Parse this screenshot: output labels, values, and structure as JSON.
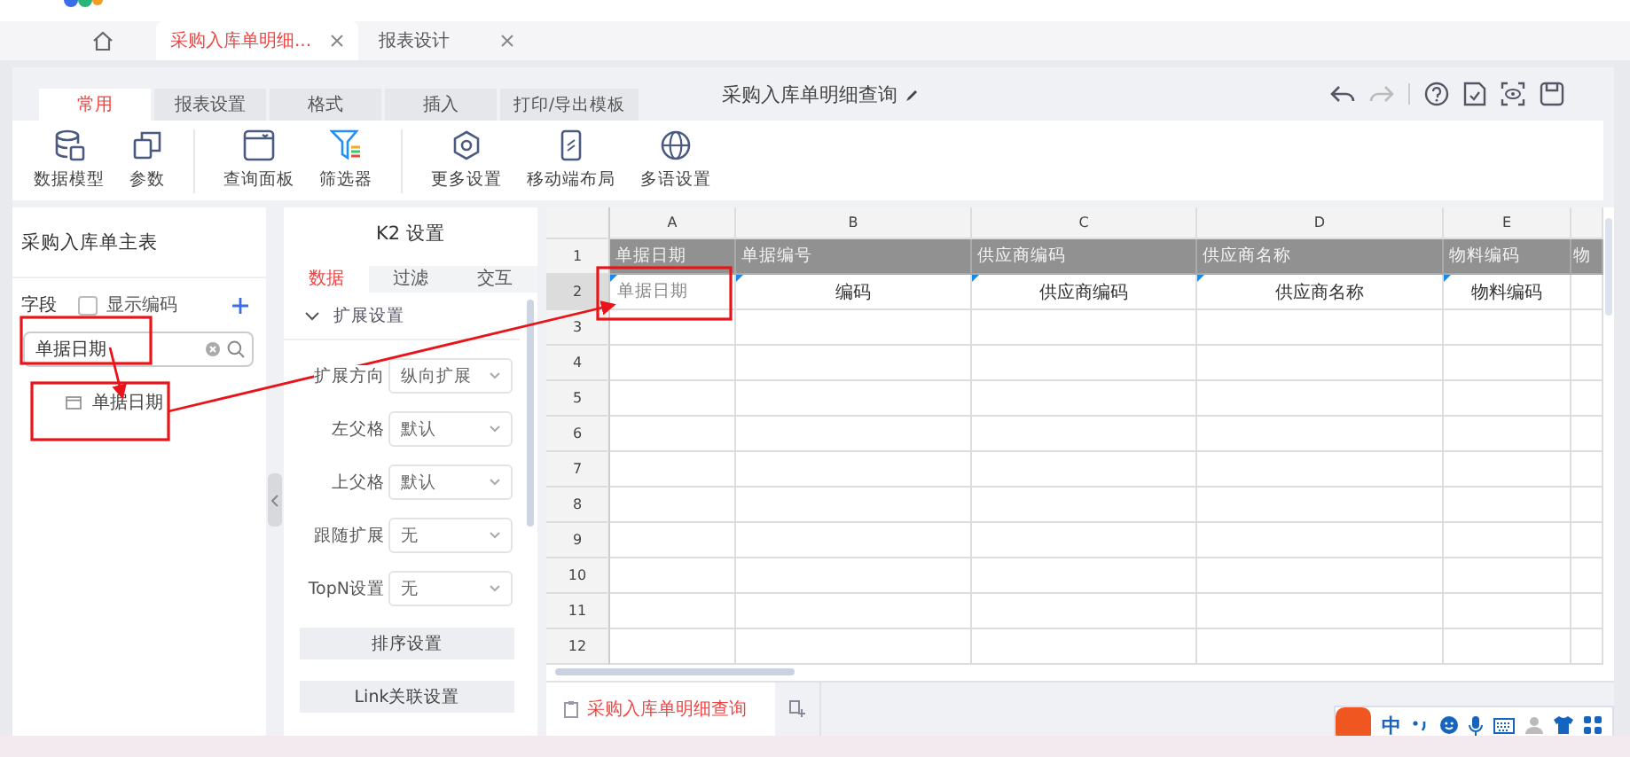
{
  "app_tabs": [
    {
      "label": "采购入库单明细...",
      "selected": true
    },
    {
      "label": "报表设计",
      "selected": false
    }
  ],
  "ribbon_tabs": [
    {
      "label": "常用",
      "selected": true
    },
    {
      "label": "报表设置",
      "selected": false
    },
    {
      "label": "格式",
      "selected": false
    },
    {
      "label": "插入",
      "selected": false
    },
    {
      "label": "打印/导出模板",
      "selected": false
    }
  ],
  "report_title": "采购入库单明细查询",
  "ribbon_groups": [
    [
      {
        "label": "数据模型",
        "kind": "database"
      },
      {
        "label": "参数",
        "kind": "copy"
      }
    ],
    [
      {
        "label": "查询面板",
        "kind": "panel"
      },
      {
        "label": "筛选器",
        "kind": "filter"
      }
    ],
    [
      {
        "label": "更多设置",
        "kind": "gear"
      },
      {
        "label": "移动端布局",
        "kind": "phone"
      },
      {
        "label": "多语设置",
        "kind": "globe"
      }
    ]
  ],
  "left_panel": {
    "title": "采购入库单主表",
    "fields_label": "字段",
    "show_code": {
      "label": "显示编码",
      "checked": false
    },
    "search": {
      "value": "单据日期"
    },
    "results": [
      {
        "label": "单据日期"
      }
    ]
  },
  "settings_panel": {
    "title": "K2 设置",
    "tabs": [
      {
        "label": "数据",
        "selected": true
      },
      {
        "label": "过滤",
        "selected": false
      },
      {
        "label": "交互",
        "selected": false
      }
    ],
    "section": {
      "label": "扩展设置",
      "expanded": true
    },
    "rows": [
      {
        "label": "扩展方向",
        "value": "纵向扩展"
      },
      {
        "label": "左父格",
        "value": "默认"
      },
      {
        "label": "上父格",
        "value": "默认"
      },
      {
        "label": "跟随扩展",
        "value": "无"
      },
      {
        "label": "TopN设置",
        "value": "无"
      }
    ],
    "buttons": [
      "排序设置",
      "Link关联设置"
    ]
  },
  "sheet": {
    "columns": [
      "A",
      "B",
      "C",
      "D",
      "E"
    ],
    "row_numbers": [
      "1",
      "2",
      "3",
      "4",
      "5",
      "6",
      "7",
      "8",
      "9",
      "10",
      "11",
      "12"
    ],
    "rows": [
      [
        "单据日期",
        "单据编号",
        "供应商编码",
        "供应商名称",
        "物料编码",
        "物"
      ],
      [
        "单据日期",
        "编码",
        "供应商编码",
        "供应商名称",
        "物料编码",
        ""
      ]
    ]
  },
  "sheet_tabs": [
    {
      "label": "采购入库单明细查询",
      "selected": true
    }
  ],
  "ime_bar": {
    "label": "中"
  }
}
